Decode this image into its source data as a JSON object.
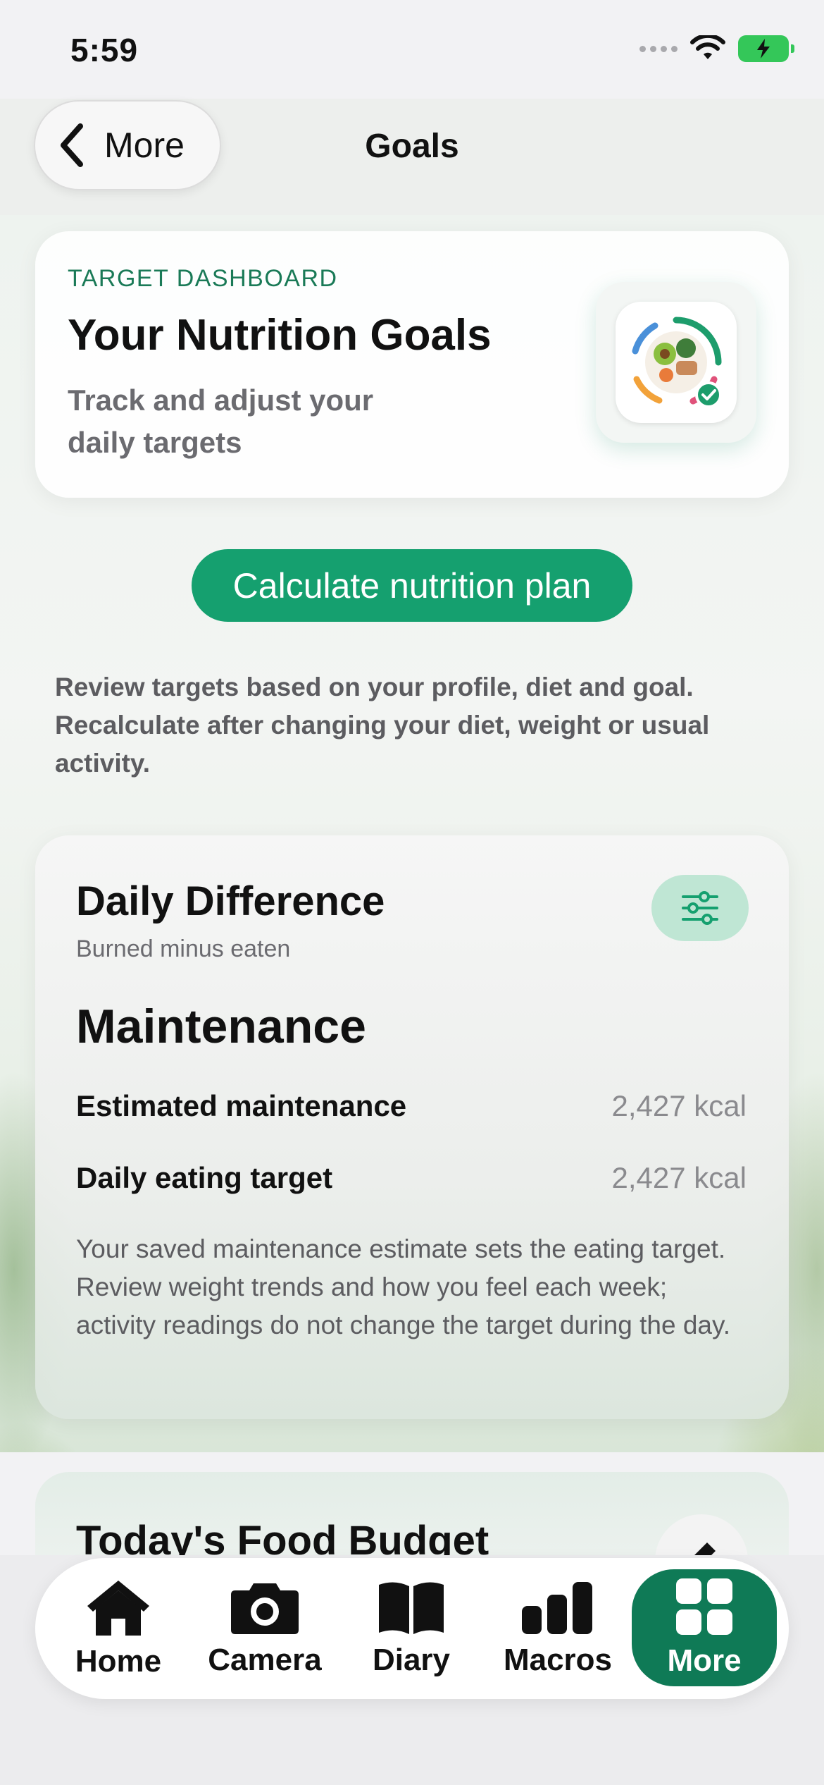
{
  "status_bar": {
    "time": "5:59"
  },
  "nav": {
    "back_label": "More",
    "title": "Goals"
  },
  "hero": {
    "eyebrow": "TARGET DASHBOARD",
    "title": "Your Nutrition Goals",
    "subtitle": "Track and adjust your daily targets"
  },
  "cta": {
    "label": "Calculate nutrition plan"
  },
  "help_text": "Review targets based on your profile, diet and goal. Recalculate after changing your diet, weight or usual activity.",
  "daily_difference": {
    "title": "Daily Difference",
    "subtitle": "Burned minus eaten",
    "mode": "Maintenance",
    "rows": [
      {
        "label": "Estimated maintenance",
        "value": "2,427 kcal"
      },
      {
        "label": "Daily eating target",
        "value": "2,427 kcal"
      }
    ],
    "description": "Your saved maintenance estimate sets the eating target. Review weight trends and how you feel each week; activity readings do not change the target during the day."
  },
  "budget": {
    "title": "Today's Food Budget"
  },
  "tabs": [
    {
      "label": "Home",
      "icon": "home-icon"
    },
    {
      "label": "Camera",
      "icon": "camera-icon"
    },
    {
      "label": "Diary",
      "icon": "book-icon"
    },
    {
      "label": "Macros",
      "icon": "bar-chart-icon"
    },
    {
      "label": "More",
      "icon": "grid-icon",
      "active": true
    }
  ],
  "colors": {
    "accent": "#15a06f",
    "active_tab": "#0f7a56",
    "eyebrow": "#1a7a57"
  }
}
